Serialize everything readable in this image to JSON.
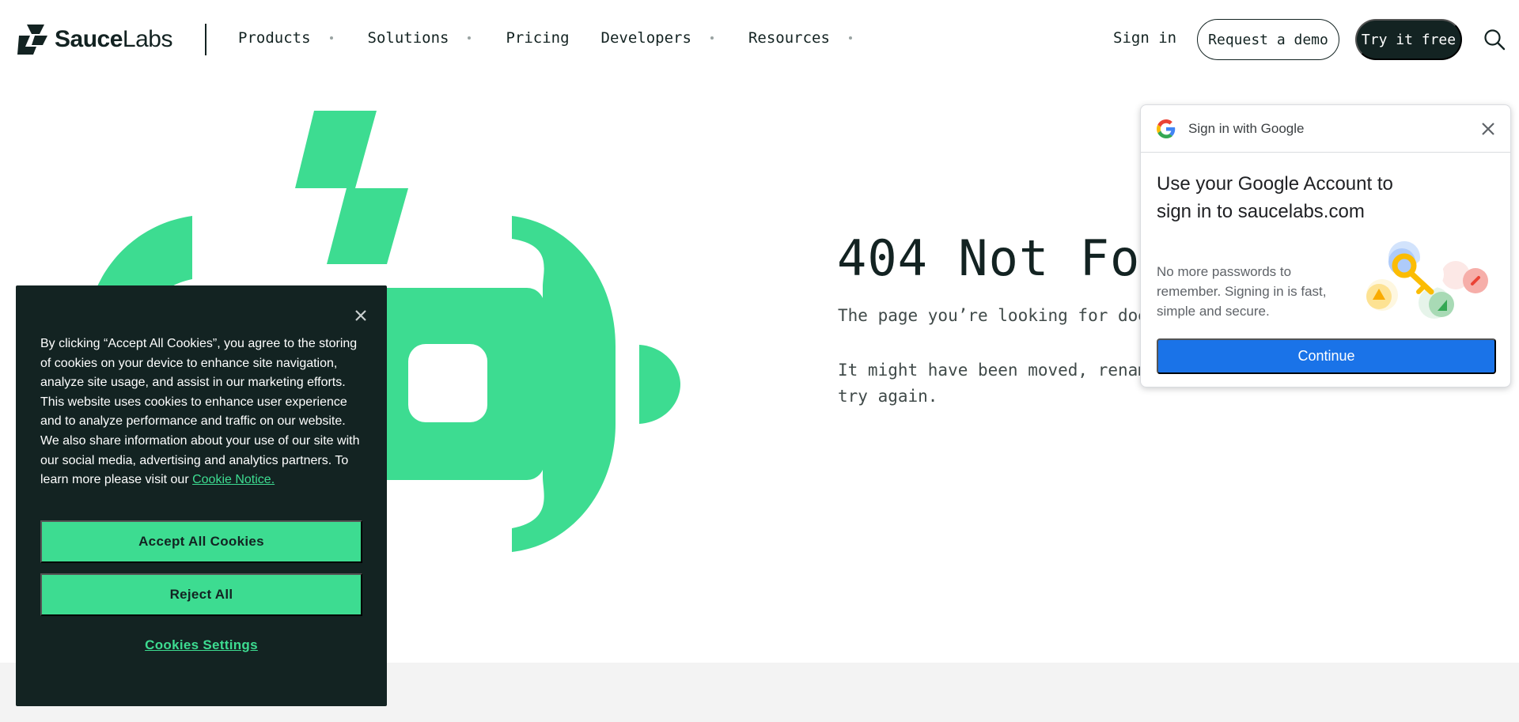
{
  "header": {
    "logo_first": "Sauce",
    "logo_second": "Labs",
    "nav": [
      {
        "label": "Products",
        "dropdown": true
      },
      {
        "label": "Solutions",
        "dropdown": true
      },
      {
        "label": "Pricing",
        "dropdown": false
      },
      {
        "label": "Developers",
        "dropdown": true
      },
      {
        "label": "Resources",
        "dropdown": true
      }
    ],
    "sign_in": "Sign in",
    "request_demo": "Request a demo",
    "try_free": "Try it free",
    "search_icon": "search-icon"
  },
  "error": {
    "title": "404 Not Found",
    "line1": "The page you’re looking for doesn’t exist.",
    "line2": "It might have been moved, renamed, or deleted. Check the URL and try again."
  },
  "google_popup": {
    "header": "Sign in with Google",
    "heading": "Use your Google Account to sign in to saucelabs.com",
    "body": "No more passwords to remember. Signing in is fast, simple and secure.",
    "continue_label": "Continue"
  },
  "cookie_banner": {
    "text": "By clicking “Accept All Cookies”, you agree to the storing of cookies on your device to enhance site navigation, analyze site usage, and assist in our marketing efforts. This website uses cookies to enhance user experience and to analyze performance and traffic on our website. We also share information about your use of our site with our social media, advertising and analytics partners. To learn more please visit our",
    "link": "Cookie Notice.",
    "accept": "Accept All Cookies",
    "reject": "Reject All",
    "settings": "Cookies Settings"
  },
  "colors": {
    "brand_green": "#3ddc91",
    "dark": "#132322",
    "google_blue": "#1a73e8"
  }
}
